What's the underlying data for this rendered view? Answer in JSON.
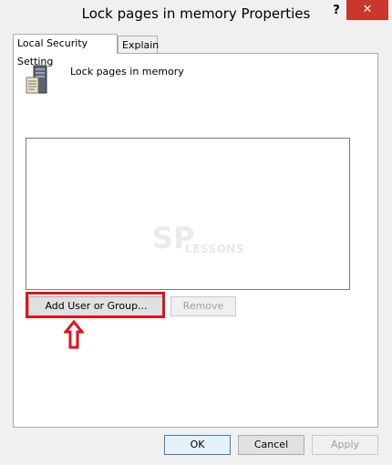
{
  "window": {
    "title": "Lock pages in memory Properties",
    "help_label": "?",
    "close_label": "✕"
  },
  "tabs": [
    {
      "label": "Local Security Setting",
      "active": true
    },
    {
      "label": "Explain",
      "active": false
    }
  ],
  "policy": {
    "icon": "server-icon",
    "name": "Lock pages in memory"
  },
  "members_list": {
    "items": []
  },
  "watermark": {
    "brand_mark": "SP",
    "brand_text": "LESSONS"
  },
  "buttons": {
    "add_user_or_group": "Add User or Group...",
    "remove": "Remove",
    "ok": "OK",
    "cancel": "Cancel",
    "apply": "Apply"
  },
  "annotation": {
    "highlight_color": "#e1131d",
    "arrow_icon": "up-arrow-icon"
  }
}
